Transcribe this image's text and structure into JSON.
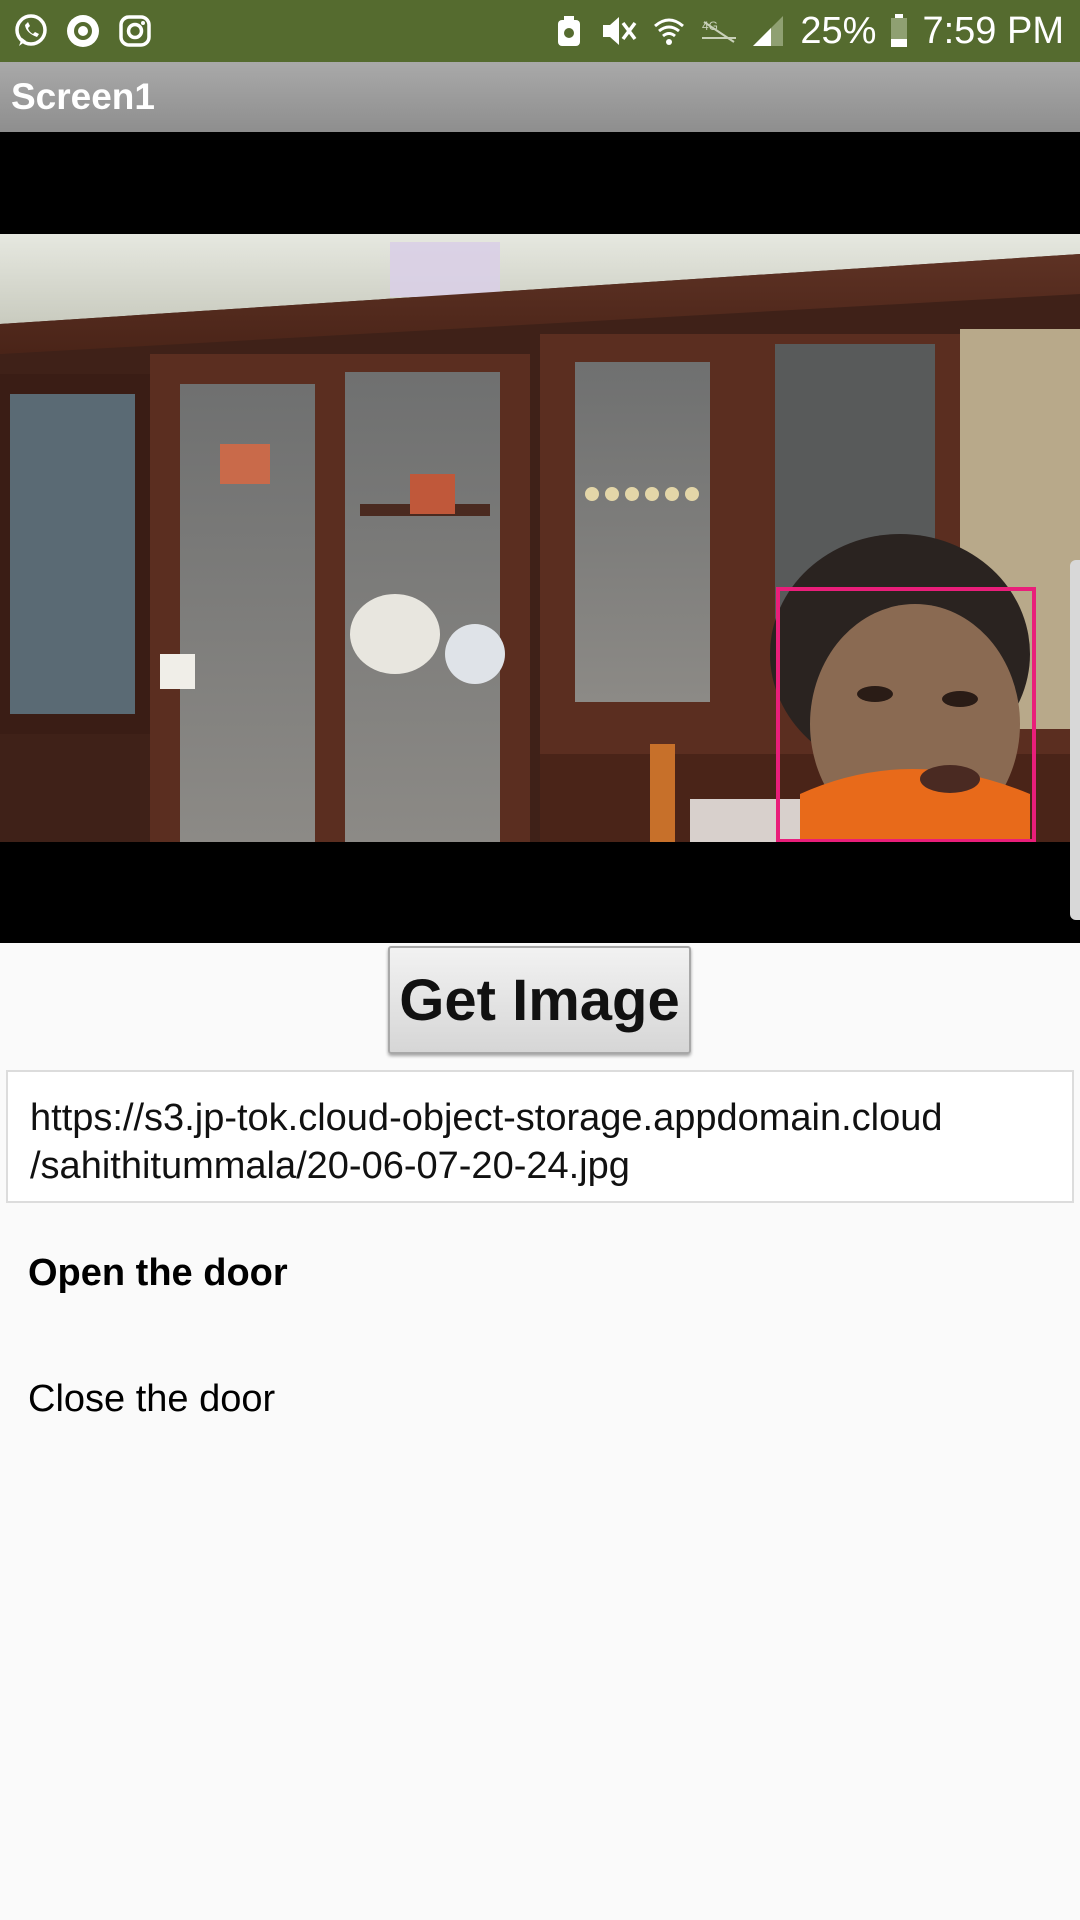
{
  "status_bar": {
    "battery_percent": "25%",
    "time": "7:59 PM",
    "left_icons": [
      "whatsapp-icon",
      "circle-app-icon",
      "instagram-icon"
    ],
    "right_icons": [
      "vpn-icon",
      "mute-icon",
      "wifi-icon",
      "lte-icon",
      "signal-icon",
      "battery-icon"
    ],
    "color": "#556b2f"
  },
  "title_bar": {
    "title": "Screen1"
  },
  "camera": {
    "face_box_color": "#e91e7a"
  },
  "actions": {
    "get_image_label": "Get Image"
  },
  "url_field": {
    "line1": "https://s3.jp-tok.cloud-object-storage.appdomain.cloud",
    "line2": "/sahithitummala/20-06-07-20-24.jpg"
  },
  "labels": {
    "open": "Open the door",
    "close": "Close the door"
  }
}
